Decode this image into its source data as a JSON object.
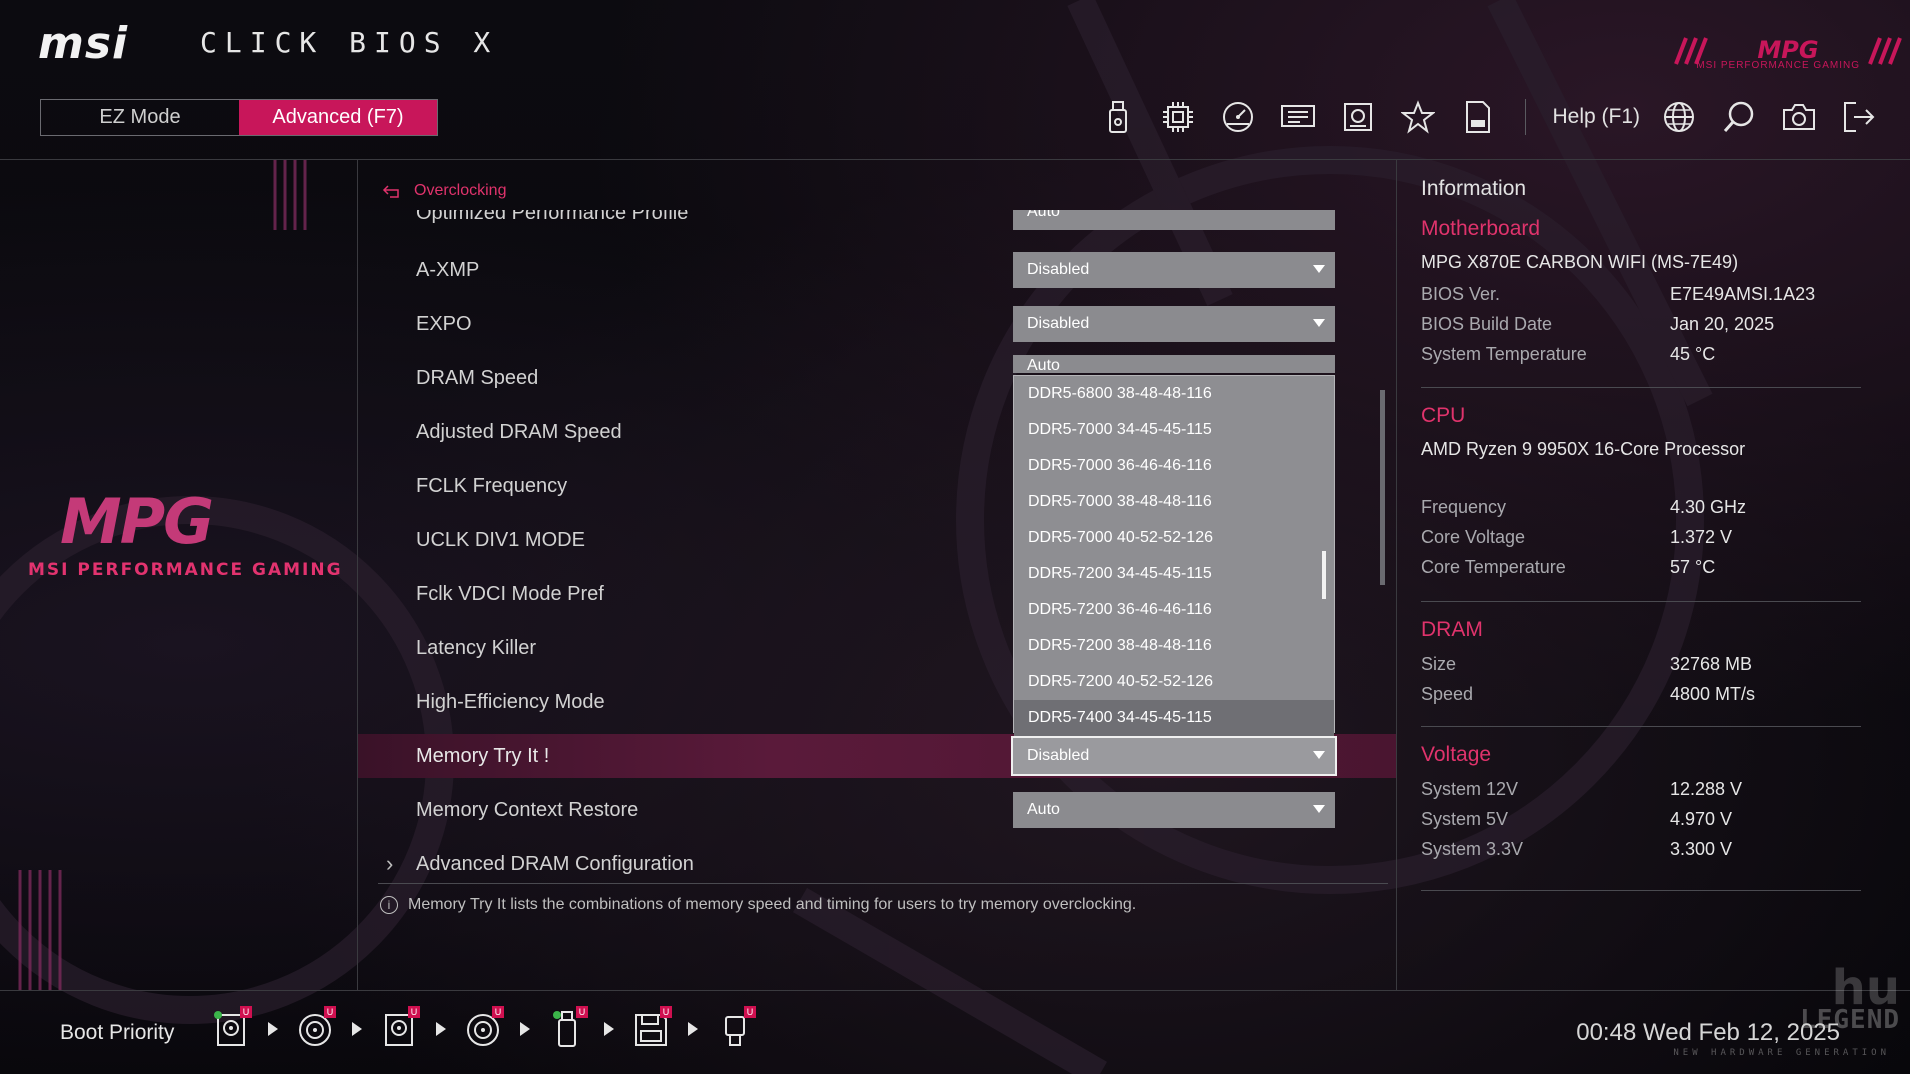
{
  "header": {
    "logo": "msi",
    "title": "CLICK BIOS X",
    "modes": [
      {
        "label": "EZ Mode",
        "active": false
      },
      {
        "label": "Advanced (F7)",
        "active": true
      }
    ],
    "toolbar_icons": [
      "usb-stick-icon",
      "cpu-chip-icon",
      "speedometer-icon",
      "memory-card-icon",
      "hardware-monitor-icon",
      "favorite-star-icon",
      "log-file-icon"
    ],
    "help_label": "Help (F1)",
    "right_icons": [
      "language-globe-icon",
      "search-icon",
      "screenshot-camera-icon",
      "exit-icon"
    ],
    "brand_sub": "MSI PERFORMANCE GAMING"
  },
  "left": {
    "logo_word": "MPG",
    "tagline": "MSI PERFORMANCE GAMING"
  },
  "main": {
    "breadcrumb": "Overclocking",
    "partial_top": {
      "label": "Optimized Performance Profile",
      "value": "Auto"
    },
    "items": [
      {
        "label": "A-XMP",
        "value": "Disabled"
      },
      {
        "label": "EXPO",
        "value": "Disabled"
      },
      {
        "label": "DRAM Speed",
        "value": "Auto"
      },
      {
        "label": "Adjusted DRAM Speed",
        "value": ""
      },
      {
        "label": "FCLK Frequency",
        "value": ""
      },
      {
        "label": "UCLK DIV1 MODE",
        "value": ""
      },
      {
        "label": "Fclk VDCI Mode Pref",
        "value": ""
      },
      {
        "label": "Latency Killer",
        "value": ""
      },
      {
        "label": "High-Efficiency Mode",
        "value": ""
      },
      {
        "label": "Memory Try It !",
        "value": "Disabled"
      },
      {
        "label": "Memory Context Restore",
        "value": "Auto"
      },
      {
        "label": "Advanced DRAM Configuration",
        "value": ""
      }
    ],
    "dropdown_options": [
      "DDR5-6800 38-48-48-116",
      "DDR5-7000 34-45-45-115",
      "DDR5-7000 36-46-46-116",
      "DDR5-7000 38-48-48-116",
      "DDR5-7000 40-52-52-126",
      "DDR5-7200 34-45-45-115",
      "DDR5-7200 36-46-46-116",
      "DDR5-7200 38-48-48-116",
      "DDR5-7200 40-52-52-126",
      "DDR5-7400 34-45-45-115"
    ],
    "hint": "Memory Try It lists the combinations of memory speed and timing for users to try memory overclocking."
  },
  "info": {
    "title": "Information",
    "motherboard": {
      "heading": "Motherboard",
      "model": "MPG X870E CARBON WIFI (MS-7E49)",
      "rows": [
        {
          "k": "BIOS Ver.",
          "v": "E7E49AMSI.1A23"
        },
        {
          "k": "BIOS Build Date",
          "v": "Jan 20, 2025"
        },
        {
          "k": "System Temperature",
          "v": "45 °C"
        }
      ]
    },
    "cpu": {
      "heading": "CPU",
      "model": "AMD Ryzen 9 9950X 16-Core Processor",
      "rows": [
        {
          "k": "Frequency",
          "v": "4.30 GHz"
        },
        {
          "k": "Core Voltage",
          "v": "1.372 V"
        },
        {
          "k": "Core Temperature",
          "v": "57 °C"
        }
      ]
    },
    "dram": {
      "heading": "DRAM",
      "rows": [
        {
          "k": "Size",
          "v": "32768 MB"
        },
        {
          "k": "Speed",
          "v": "4800 MT/s"
        }
      ]
    },
    "voltage": {
      "heading": "Voltage",
      "rows": [
        {
          "k": "System 12V",
          "v": "12.288 V"
        },
        {
          "k": "System 5V",
          "v": "4.970 V"
        },
        {
          "k": "System 3.3V",
          "v": "3.300 V"
        }
      ]
    }
  },
  "footer": {
    "boot_label": "Boot Priority",
    "boot_devices": [
      "hdd-icon",
      "optical-disc-icon",
      "hdd-icon",
      "optical-disc-icon",
      "usb-drive-icon",
      "floppy-icon",
      "usb-key-icon"
    ],
    "time": "00:48",
    "date": "Wed Feb 12, 2025"
  },
  "watermark": {
    "big": "hu",
    "word": "LEGEND",
    "sub": "NEW HARDWARE GENERATION"
  },
  "colors": {
    "accent": "#c8165a",
    "accent_text": "#e0336c",
    "select_bg": "#8b8b8f"
  }
}
